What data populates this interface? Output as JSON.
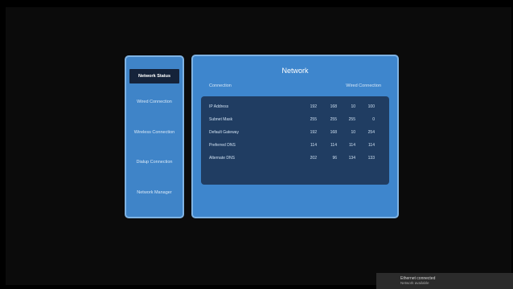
{
  "sidebar": {
    "items": [
      {
        "label": "Network Status"
      },
      {
        "label": "Wired Connection"
      },
      {
        "label": "Wireless Connection"
      },
      {
        "label": "Dialup Connection"
      },
      {
        "label": "Network Manager"
      }
    ]
  },
  "panel": {
    "title": "Network",
    "header_left": "Connection",
    "header_right": "Wired Connection",
    "rows": [
      {
        "label": "IP Address",
        "values": [
          "192",
          "168",
          "10",
          "100"
        ]
      },
      {
        "label": "Subnet Mask",
        "values": [
          "255",
          "255",
          "255",
          "0"
        ]
      },
      {
        "label": "Default Gateway",
        "values": [
          "192",
          "168",
          "10",
          "254"
        ]
      },
      {
        "label": "Preferred DNS",
        "values": [
          "114",
          "114",
          "114",
          "114"
        ]
      },
      {
        "label": "Alternate DNS",
        "values": [
          "202",
          "96",
          "134",
          "133"
        ]
      }
    ]
  },
  "status": {
    "line1": "Ethernet connected",
    "line2": "Network available"
  }
}
